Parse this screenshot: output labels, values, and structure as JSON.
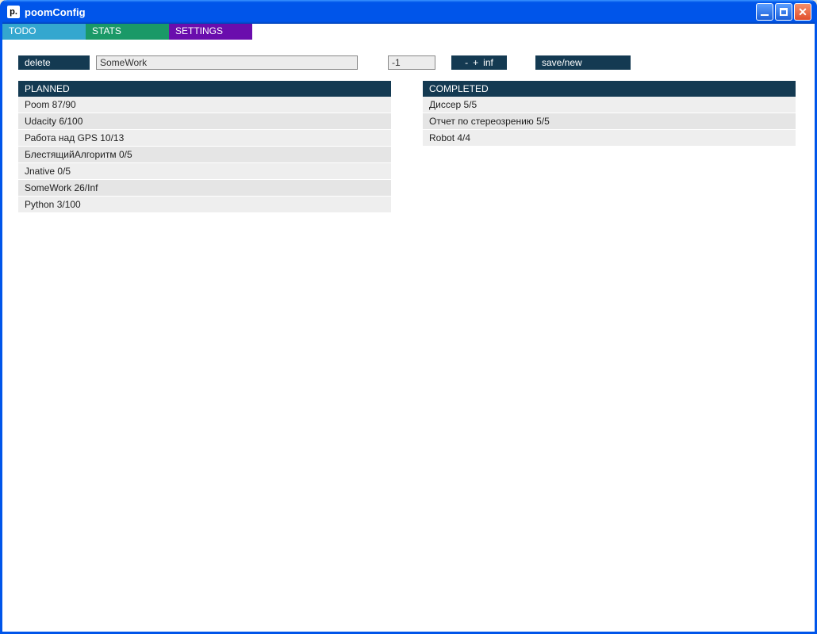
{
  "window": {
    "title": "poomConfig",
    "app_icon_glyph": "p."
  },
  "tabs": {
    "todo": "TODO",
    "stats": "STATS",
    "settings": "SETTINGS"
  },
  "toolbar": {
    "delete_label": "delete",
    "name_value": "SomeWork",
    "num_value": "-1",
    "minus": "-",
    "plus": "+",
    "inf": "inf",
    "save_label": "save/new"
  },
  "planned": {
    "header": "PLANNED",
    "items": [
      "Poom 87/90",
      "Udacity 6/100",
      "Работа над GPS 10/13",
      "БлестящийАлгоритм 0/5",
      "Jnative 0/5",
      "SomeWork 26/Inf",
      "Python 3/100"
    ]
  },
  "completed": {
    "header": "COMPLETED",
    "items": [
      "Диссер 5/5",
      "Отчет по стереозрению 5/5",
      "Robot 4/4"
    ]
  }
}
